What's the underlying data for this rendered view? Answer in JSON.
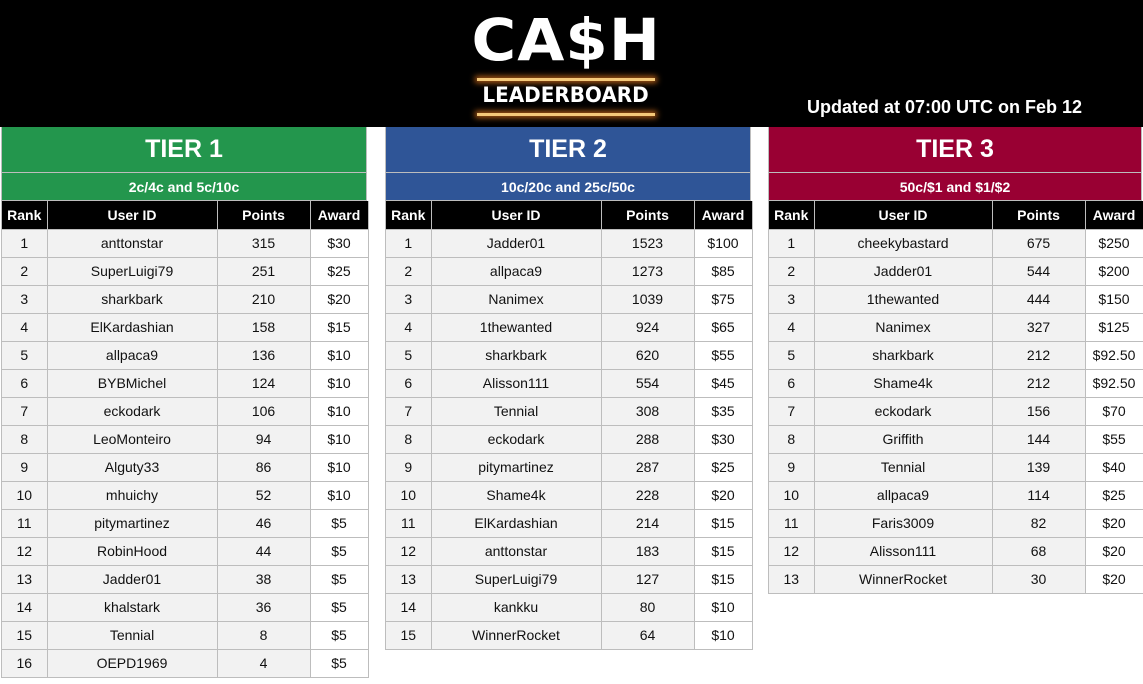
{
  "header": {
    "logo_title": "CA$H",
    "logo_subtitle": "LEADERBOARD",
    "updated_text": "Updated at 07:00 UTC on Feb 12"
  },
  "columns": {
    "rank": "Rank",
    "user_id": "User ID",
    "points": "Points",
    "award": "Award"
  },
  "tiers": [
    {
      "title": "TIER 1",
      "stakes": "2c/4c and 5c/10c",
      "color": "#23964d",
      "rows": [
        {
          "rank": "1",
          "user": "anttonstar",
          "points": "315",
          "award": "$30"
        },
        {
          "rank": "2",
          "user": "SuperLuigi79",
          "points": "251",
          "award": "$25"
        },
        {
          "rank": "3",
          "user": "sharkbark",
          "points": "210",
          "award": "$20"
        },
        {
          "rank": "4",
          "user": "ElKardashian",
          "points": "158",
          "award": "$15"
        },
        {
          "rank": "5",
          "user": "allpaca9",
          "points": "136",
          "award": "$10"
        },
        {
          "rank": "6",
          "user": "BYBMichel",
          "points": "124",
          "award": "$10"
        },
        {
          "rank": "7",
          "user": "eckodark",
          "points": "106",
          "award": "$10"
        },
        {
          "rank": "8",
          "user": "LeoMonteiro",
          "points": "94",
          "award": "$10"
        },
        {
          "rank": "9",
          "user": "Alguty33",
          "points": "86",
          "award": "$10"
        },
        {
          "rank": "10",
          "user": "mhuichy",
          "points": "52",
          "award": "$10"
        },
        {
          "rank": "11",
          "user": "pitymartinez",
          "points": "46",
          "award": "$5"
        },
        {
          "rank": "12",
          "user": "RobinHood",
          "points": "44",
          "award": "$5"
        },
        {
          "rank": "13",
          "user": "Jadder01",
          "points": "38",
          "award": "$5"
        },
        {
          "rank": "14",
          "user": "khalstark",
          "points": "36",
          "award": "$5"
        },
        {
          "rank": "15",
          "user": "Tennial",
          "points": "8",
          "award": "$5"
        },
        {
          "rank": "16",
          "user": "OEPD1969",
          "points": "4",
          "award": "$5"
        }
      ]
    },
    {
      "title": "TIER 2",
      "stakes": "10c/20c and 25c/50c",
      "color": "#2f5597",
      "rows": [
        {
          "rank": "1",
          "user": "Jadder01",
          "points": "1523",
          "award": "$100"
        },
        {
          "rank": "2",
          "user": "allpaca9",
          "points": "1273",
          "award": "$85"
        },
        {
          "rank": "3",
          "user": "Nanimex",
          "points": "1039",
          "award": "$75"
        },
        {
          "rank": "4",
          "user": "1thewanted",
          "points": "924",
          "award": "$65"
        },
        {
          "rank": "5",
          "user": "sharkbark",
          "points": "620",
          "award": "$55"
        },
        {
          "rank": "6",
          "user": "Alisson111",
          "points": "554",
          "award": "$45"
        },
        {
          "rank": "7",
          "user": "Tennial",
          "points": "308",
          "award": "$35"
        },
        {
          "rank": "8",
          "user": "eckodark",
          "points": "288",
          "award": "$30"
        },
        {
          "rank": "9",
          "user": "pitymartinez",
          "points": "287",
          "award": "$25"
        },
        {
          "rank": "10",
          "user": "Shame4k",
          "points": "228",
          "award": "$20"
        },
        {
          "rank": "11",
          "user": "ElKardashian",
          "points": "214",
          "award": "$15"
        },
        {
          "rank": "12",
          "user": "anttonstar",
          "points": "183",
          "award": "$15"
        },
        {
          "rank": "13",
          "user": "SuperLuigi79",
          "points": "127",
          "award": "$15"
        },
        {
          "rank": "14",
          "user": "kankku",
          "points": "80",
          "award": "$10"
        },
        {
          "rank": "15",
          "user": "WinnerRocket",
          "points": "64",
          "award": "$10"
        }
      ]
    },
    {
      "title": "TIER 3",
      "stakes": "50c/$1 and $1/$2",
      "color": "#990033",
      "rows": [
        {
          "rank": "1",
          "user": "cheekybastard",
          "points": "675",
          "award": "$250"
        },
        {
          "rank": "2",
          "user": "Jadder01",
          "points": "544",
          "award": "$200"
        },
        {
          "rank": "3",
          "user": "1thewanted",
          "points": "444",
          "award": "$150"
        },
        {
          "rank": "4",
          "user": "Nanimex",
          "points": "327",
          "award": "$125"
        },
        {
          "rank": "5",
          "user": "sharkbark",
          "points": "212",
          "award": "$92.50"
        },
        {
          "rank": "6",
          "user": "Shame4k",
          "points": "212",
          "award": "$92.50"
        },
        {
          "rank": "7",
          "user": "eckodark",
          "points": "156",
          "award": "$70"
        },
        {
          "rank": "8",
          "user": "Griffith",
          "points": "144",
          "award": "$55"
        },
        {
          "rank": "9",
          "user": "Tennial",
          "points": "139",
          "award": "$40"
        },
        {
          "rank": "10",
          "user": "allpaca9",
          "points": "114",
          "award": "$25"
        },
        {
          "rank": "11",
          "user": "Faris3009",
          "points": "82",
          "award": "$20"
        },
        {
          "rank": "12",
          "user": "Alisson111",
          "points": "68",
          "award": "$20"
        },
        {
          "rank": "13",
          "user": "WinnerRocket",
          "points": "30",
          "award": "$20"
        }
      ]
    }
  ]
}
